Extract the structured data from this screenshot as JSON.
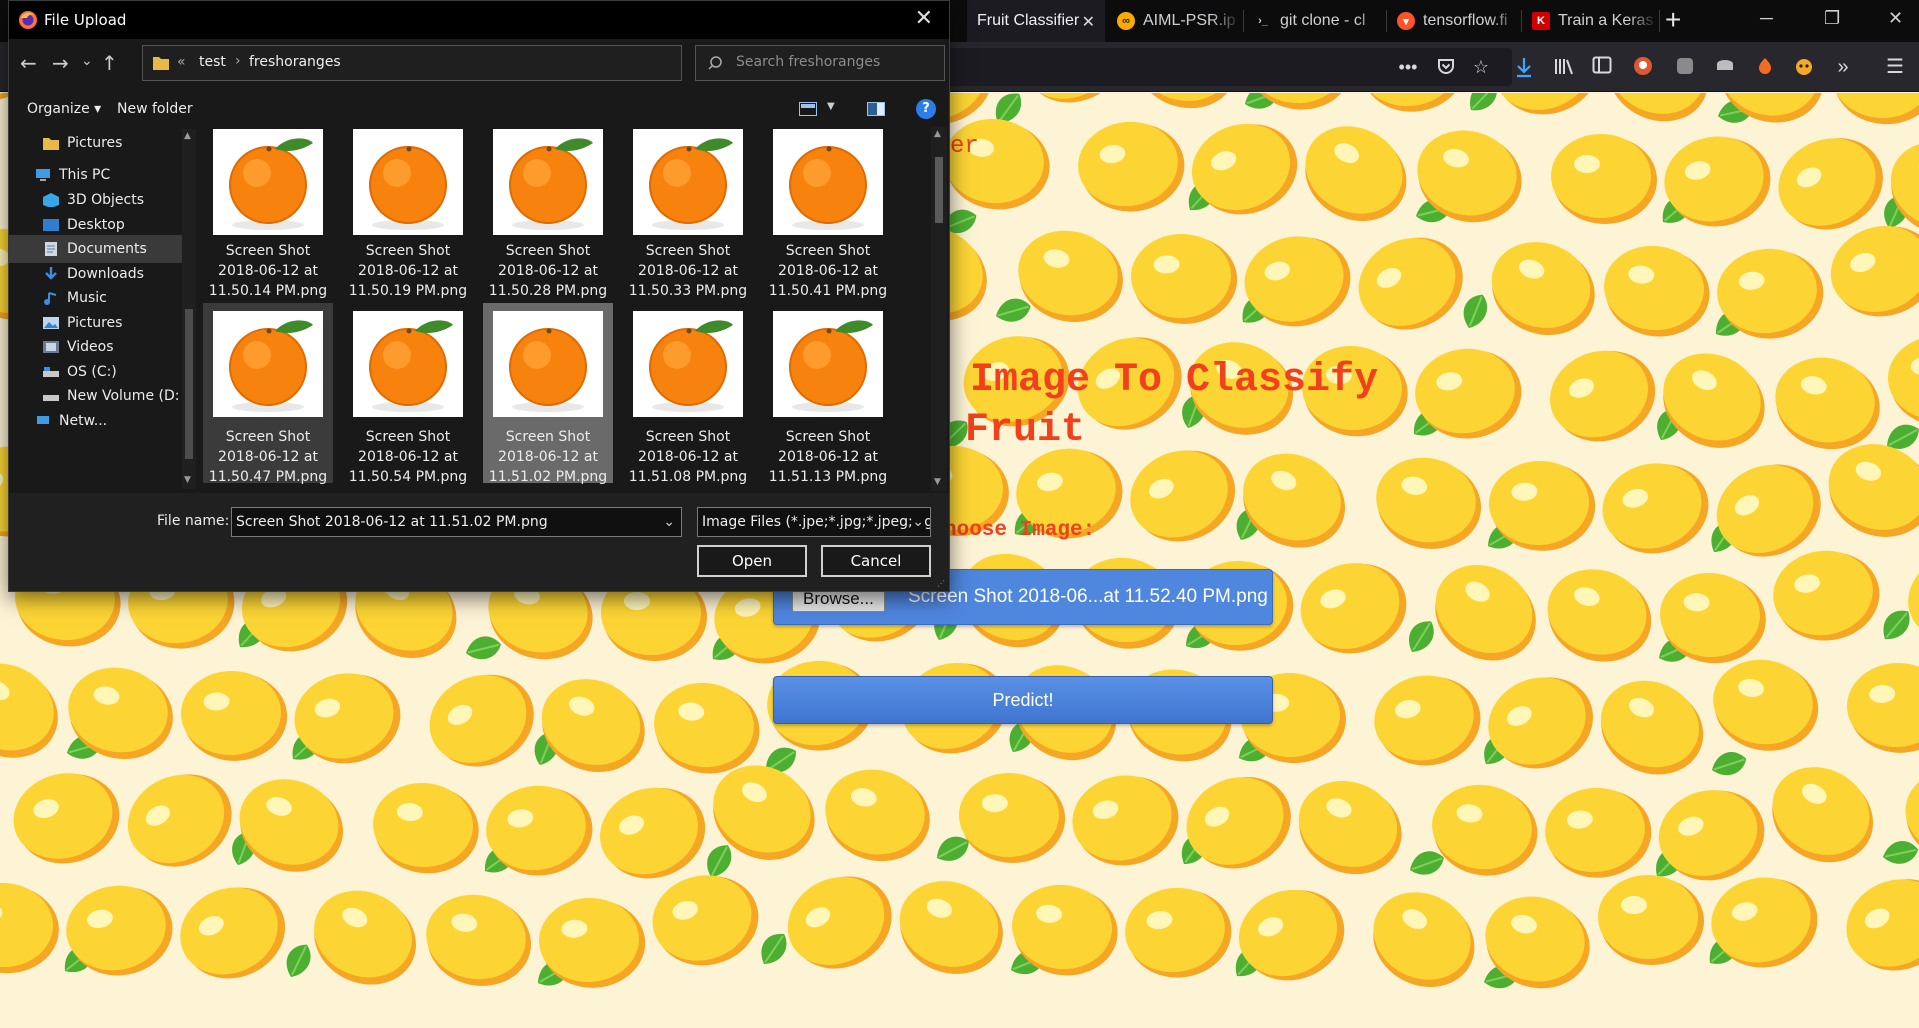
{
  "browser": {
    "tabs": [
      {
        "label": "Fruit Classifier",
        "active": true,
        "icon": "close-icon"
      },
      {
        "label": "AIML-PSR.ip",
        "icon": "colab-icon"
      },
      {
        "label": "git clone - cl",
        "icon": "terminal-icon"
      },
      {
        "label": "tensorflow.fi",
        "icon": "brave-icon"
      },
      {
        "label": "Train a Keras",
        "icon": "keras-icon"
      }
    ],
    "new_tab": "+",
    "window_controls": {
      "minimize": "─",
      "restore": "❐",
      "close": "✕"
    },
    "toolbar_icons": [
      "more-icon",
      "pocket-icon",
      "star-icon",
      "download-icon",
      "library-icon",
      "sidebar-icon",
      "ext-icon",
      "ext-icon",
      "ext-icon",
      "ext-icon",
      "ext-icon",
      "overflow-icon",
      "menu-icon"
    ]
  },
  "page": {
    "header_fragment": "er",
    "heading_line1": "Image To Classify",
    "heading_line2": "Fruit",
    "choose_label": "hoose Image:",
    "browse_label": "Browse...",
    "chosen_file": "Screen Shot 2018-06...at 11.52.40 PM.png",
    "predict_label": "Predict!",
    "colors": {
      "heading": "#f0401c",
      "button": "#4f86de",
      "background": "#fdf3d5"
    }
  },
  "dialog": {
    "title": "File Upload",
    "close": "✕",
    "nav": {
      "back": "←",
      "forward": "→",
      "recent": "⌄",
      "up": "↑"
    },
    "path": {
      "prefix": "«",
      "segments": [
        "test",
        "freshoranges"
      ],
      "dropdown": "⌄",
      "refresh": "↻"
    },
    "search_placeholder": "Search freshoranges",
    "commands": {
      "organize": "Organize ▾",
      "new_folder": "New folder",
      "help": "?"
    },
    "nav_pane": [
      {
        "label": "Pictures",
        "icon": "folder-icon"
      },
      {
        "label": "This PC",
        "icon": "pc-icon"
      },
      {
        "label": "3D Objects",
        "icon": "3d-objects-icon"
      },
      {
        "label": "Desktop",
        "icon": "desktop-icon"
      },
      {
        "label": "Documents",
        "icon": "documents-icon",
        "selected": true
      },
      {
        "label": "Downloads",
        "icon": "downloads-icon"
      },
      {
        "label": "Music",
        "icon": "music-icon"
      },
      {
        "label": "Pictures",
        "icon": "pictures-icon"
      },
      {
        "label": "Videos",
        "icon": "videos-icon"
      },
      {
        "label": "OS (C:)",
        "icon": "drive-icon"
      },
      {
        "label": "New Volume (D:",
        "icon": "drive-icon"
      },
      {
        "label": "Netw...",
        "icon": "network-icon"
      }
    ],
    "files": [
      {
        "name1": "Screen Shot",
        "name2": "2018-06-12 at",
        "name3": "11.50.14 PM.png"
      },
      {
        "name1": "Screen Shot",
        "name2": "2018-06-12 at",
        "name3": "11.50.19 PM.png"
      },
      {
        "name1": "Screen Shot",
        "name2": "2018-06-12 at",
        "name3": "11.50.28 PM.png"
      },
      {
        "name1": "Screen Shot",
        "name2": "2018-06-12 at",
        "name3": "11.50.33 PM.png"
      },
      {
        "name1": "Screen Shot",
        "name2": "2018-06-12 at",
        "name3": "11.50.41 PM.png"
      },
      {
        "name1": "Screen Shot",
        "name2": "2018-06-12 at",
        "name3": "11.50.47 PM.png",
        "state": "hover"
      },
      {
        "name1": "Screen Shot",
        "name2": "2018-06-12 at",
        "name3": "11.50.54 PM.png"
      },
      {
        "name1": "Screen Shot",
        "name2": "2018-06-12 at",
        "name3": "11.51.02 PM.png",
        "state": "selected"
      },
      {
        "name1": "Screen Shot",
        "name2": "2018-06-12 at",
        "name3": "11.51.08 PM.png"
      },
      {
        "name1": "Screen Shot",
        "name2": "2018-06-12 at",
        "name3": "11.51.13 PM.png"
      }
    ],
    "filename_label": "File name:",
    "filename_value": "Screen Shot 2018-06-12 at 11.51.02 PM.png",
    "filetype_value": "Image Files (*.jpe;*.jpg;*.jpeg;*.g",
    "open_label": "Open",
    "cancel_label": "Cancel"
  }
}
